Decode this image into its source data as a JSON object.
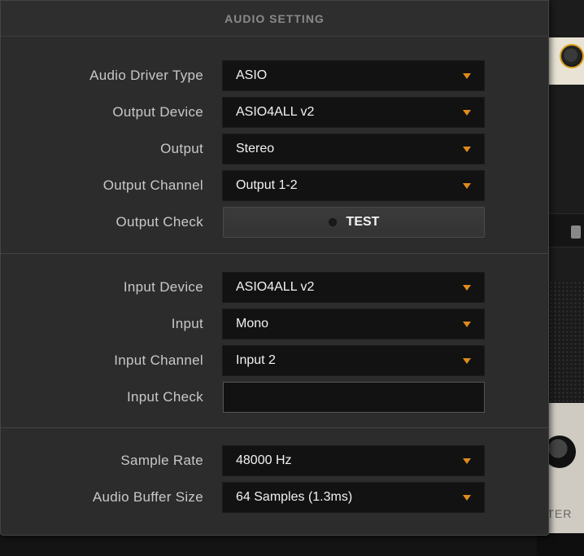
{
  "dialog": {
    "title": "AUDIO SETTING"
  },
  "output_section": {
    "driver_type": {
      "label": "Audio Driver Type",
      "value": "ASIO"
    },
    "output_device": {
      "label": "Output Device",
      "value": "ASIO4ALL v2"
    },
    "output": {
      "label": "Output",
      "value": "Stereo"
    },
    "output_channel": {
      "label": "Output Channel",
      "value": "Output 1-2"
    },
    "output_check": {
      "label": "Output Check",
      "button": "TEST"
    }
  },
  "input_section": {
    "input_device": {
      "label": "Input Device",
      "value": "ASIO4ALL v2"
    },
    "input": {
      "label": "Input",
      "value": "Mono"
    },
    "input_channel": {
      "label": "Input Channel",
      "value": "Input 2"
    },
    "input_check": {
      "label": "Input Check"
    }
  },
  "rate_section": {
    "sample_rate": {
      "label": "Sample Rate",
      "value": "48000 Hz"
    },
    "buffer_size": {
      "label": "Audio Buffer Size",
      "value": "64 Samples (1.3ms)"
    }
  },
  "background_app": {
    "partial_label": "STER"
  },
  "colors": {
    "accent": "#e08a1e",
    "panel": "#2c2c2c",
    "field": "#121212"
  }
}
